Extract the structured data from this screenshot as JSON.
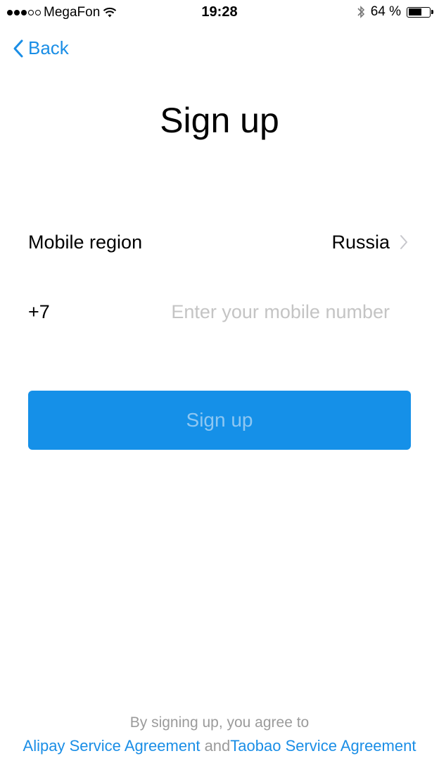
{
  "status_bar": {
    "carrier": "MegaFon",
    "time": "19:28",
    "battery_percent": "64 %",
    "battery_level": 0.64,
    "signal_strength": 3,
    "signal_max": 5
  },
  "nav": {
    "back_label": "Back"
  },
  "page": {
    "title": "Sign up"
  },
  "form": {
    "region_label": "Mobile region",
    "region_value": "Russia",
    "country_code": "+7",
    "phone_placeholder": "Enter your mobile number",
    "submit_label": "Sign up"
  },
  "footer": {
    "note": "By signing up, you agree to",
    "agreement_1": "Alipay Service Agreement",
    "conjunction": "and",
    "agreement_2": "Taobao Service Agreement"
  },
  "colors": {
    "accent": "#1a8ee6",
    "button_bg": "#1590e8",
    "button_text_disabled": "#8ec7f2",
    "placeholder": "#c4c4c4",
    "muted_text": "#9b9b9b"
  }
}
